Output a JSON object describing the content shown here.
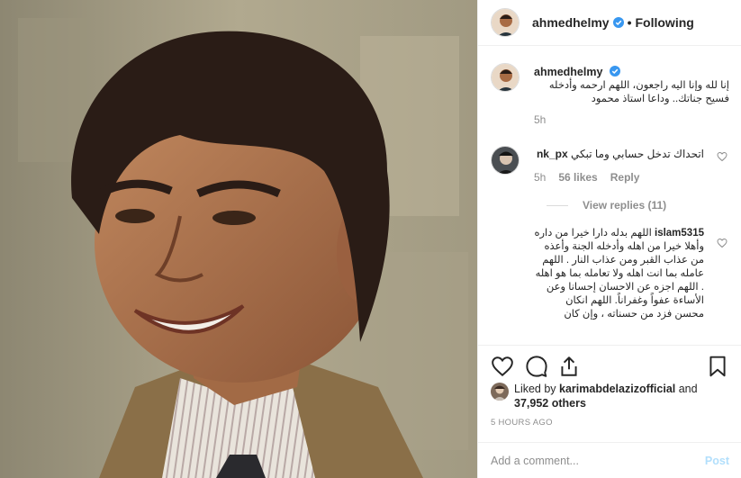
{
  "photo": {
    "alt_subject": "portrait"
  },
  "header": {
    "username": "ahmedhelmy",
    "separator": "•",
    "follow_label": "Following"
  },
  "caption": {
    "username": "ahmedhelmy",
    "text": "إنا لله وإنا اليه راجعون، اللهم ارحمه وأدخله فسيح جناتك.. وداعا استاذ محمود",
    "time": "5h"
  },
  "comments": [
    {
      "username": "nk_px",
      "text": "اتحداك تدخل حسابي وما تبكي",
      "time": "5h",
      "likes": "56 likes",
      "reply_label": "Reply",
      "view_replies": "View replies (11)"
    },
    {
      "username": "islam5315",
      "text": "اللهم بدله دارا خيرا من داره وأهلا خيرا من اهله وأدخله الجنة وأعذه من عذاب القبر ومن عذاب النار . اللهم عامله بما انت اهله ولا تعامله بما هو اهله . اللهم اجزه عن الاحسان إحسانا وعن الأساءة عفواً وغفراناً. اللهم انكان محسن فزد من حسناته ، وإن كان"
    }
  ],
  "likes": {
    "prefix": "Liked by ",
    "user": "karimabdelazizofficial",
    "middle": " and",
    "count": "37,952 others"
  },
  "timestamp": "5 HOURS AGO",
  "add_comment": {
    "placeholder": "Add a comment...",
    "post_label": "Post"
  },
  "colors": {
    "link_blue": "#0095f6",
    "post_disabled": "#b2dffc",
    "border": "#efefef",
    "muted": "#8e8e8e"
  },
  "icons": [
    "verified-icon",
    "heart-icon",
    "comment-icon",
    "share-icon",
    "bookmark-icon"
  ]
}
